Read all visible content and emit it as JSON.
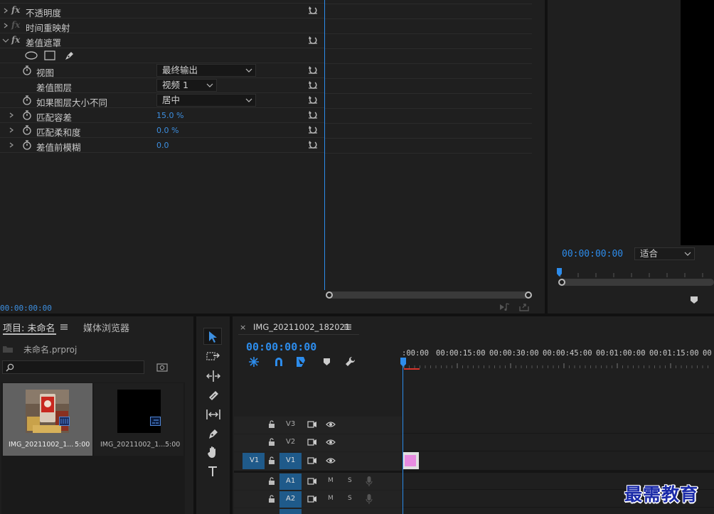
{
  "effects": {
    "rows": [
      {
        "label": "不透明度",
        "fx": true,
        "expanded": false
      },
      {
        "label": "时间重映射",
        "fx": true,
        "expanded": false
      },
      {
        "label": "差值遮罩",
        "fx": true,
        "expanded": true
      }
    ],
    "props": {
      "view": {
        "label": "视图",
        "value": "最终输出"
      },
      "layer": {
        "label": "差值图层",
        "value": "视频 1"
      },
      "if_size": {
        "label": "如果图层大小不同",
        "value": "居中"
      },
      "tolerance": {
        "label": "匹配容差",
        "value": "15.0 %"
      },
      "softness": {
        "label": "匹配柔和度",
        "value": "0.0 %"
      },
      "blur": {
        "label": "差值前模糊",
        "value": "0.0"
      }
    },
    "timecode": "00:00:00:00"
  },
  "monitor": {
    "timecode": "00:00:00:00",
    "fit": "适合"
  },
  "project": {
    "tab_active": "项目: 未命名",
    "tab_other": "媒体浏览器",
    "file": "未命名.prproj",
    "search_placeholder": "",
    "items": [
      {
        "name": "IMG_20211002_1...",
        "duration": "5:00"
      },
      {
        "name": "IMG_20211002_1...",
        "duration": "5:00"
      }
    ]
  },
  "timeline": {
    "close": "×",
    "sequence_name": "IMG_20211002_182021",
    "timecode": "00:00:00:00",
    "ruler": [
      ":00:00",
      "00:00:15:00",
      "00:00:30:00",
      "00:00:45:00",
      "00:01:00:00",
      "00:01:15:00",
      "00"
    ],
    "tracks": {
      "v3": "V3",
      "v2": "V2",
      "v1_src": "V1",
      "v1": "V1",
      "a1": "A1",
      "a2": "A2",
      "m": "M",
      "s": "S"
    }
  },
  "watermark": "最需教育",
  "colors": {
    "accent": "#2d8ceb",
    "clip": "#e78be0",
    "track_active": "#1f5a8a"
  }
}
